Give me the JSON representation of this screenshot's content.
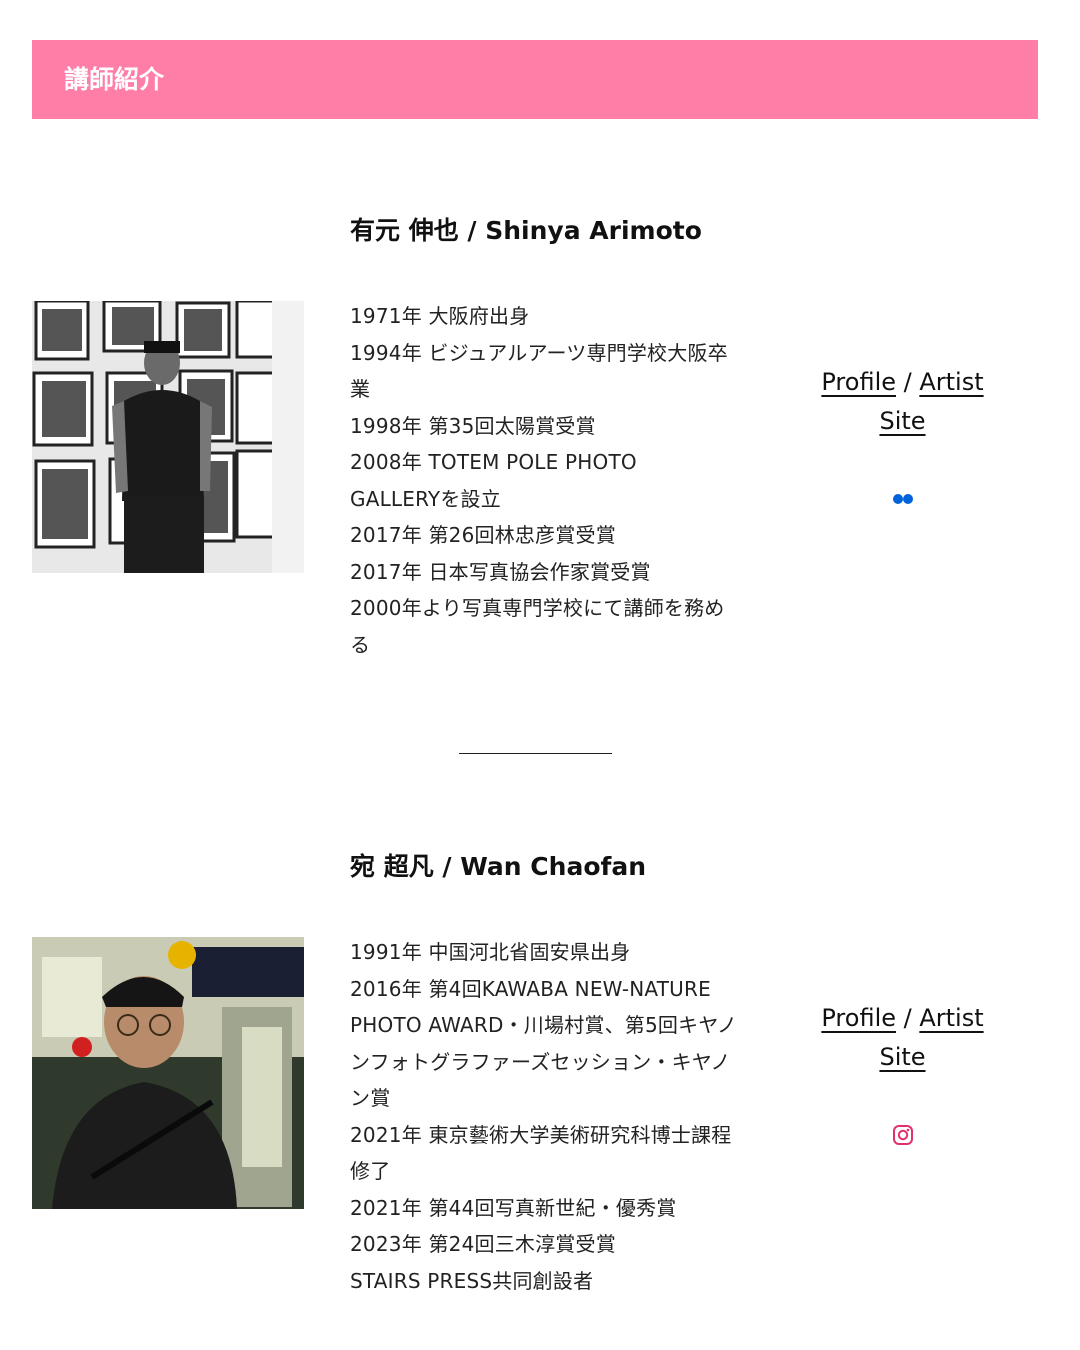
{
  "section": {
    "title": "講師紹介"
  },
  "colors": {
    "header_bg": "#ff7ea8",
    "flickr_blue": "#0063dc",
    "flickr_pink": "#ff0084",
    "instagram": "#e1306c"
  },
  "instructors": [
    {
      "name": "有元 伸也 / Shinya Arimoto",
      "bio": [
        "1971年 大阪府出身",
        "1994年 ビジュアルアーツ専門学校大阪卒",
        "業",
        "1998年 第35回太陽賞受賞",
        "2008年 TOTEM POLE PHOTO",
        "GALLERYを設立",
        "2017年 第26回林忠彦賞受賞",
        "2017年 日本写真協会作家賞受賞",
        "2000年より写真専門学校にて講師を務め",
        "る"
      ],
      "links": {
        "profile": "Profile",
        "separator": " / ",
        "artist_line1": "Artist",
        "artist_line2": "Site"
      },
      "social_icon": "flickr-icon"
    },
    {
      "name": "宛 超凡 / Wan Chaofan",
      "bio": [
        "1991年 中国河北省固安県出身",
        "2016年 第4回KAWABA NEW-NATURE",
        "PHOTO AWARD・川場村賞、第5回キヤノ",
        "ンフォトグラファーズセッション・キヤノ",
        "ン賞",
        "2021年 東京藝術大学美術研究科博士課程",
        "修了",
        "2021年 第44回写真新世紀・優秀賞",
        "2023年 第24回三木淳賞受賞",
        "STAIRS PRESS共同創設者"
      ],
      "links": {
        "profile": "Profile",
        "separator": " / ",
        "artist_line1": "Artist",
        "artist_line2": "Site"
      },
      "social_icon": "instagram-icon"
    }
  ]
}
